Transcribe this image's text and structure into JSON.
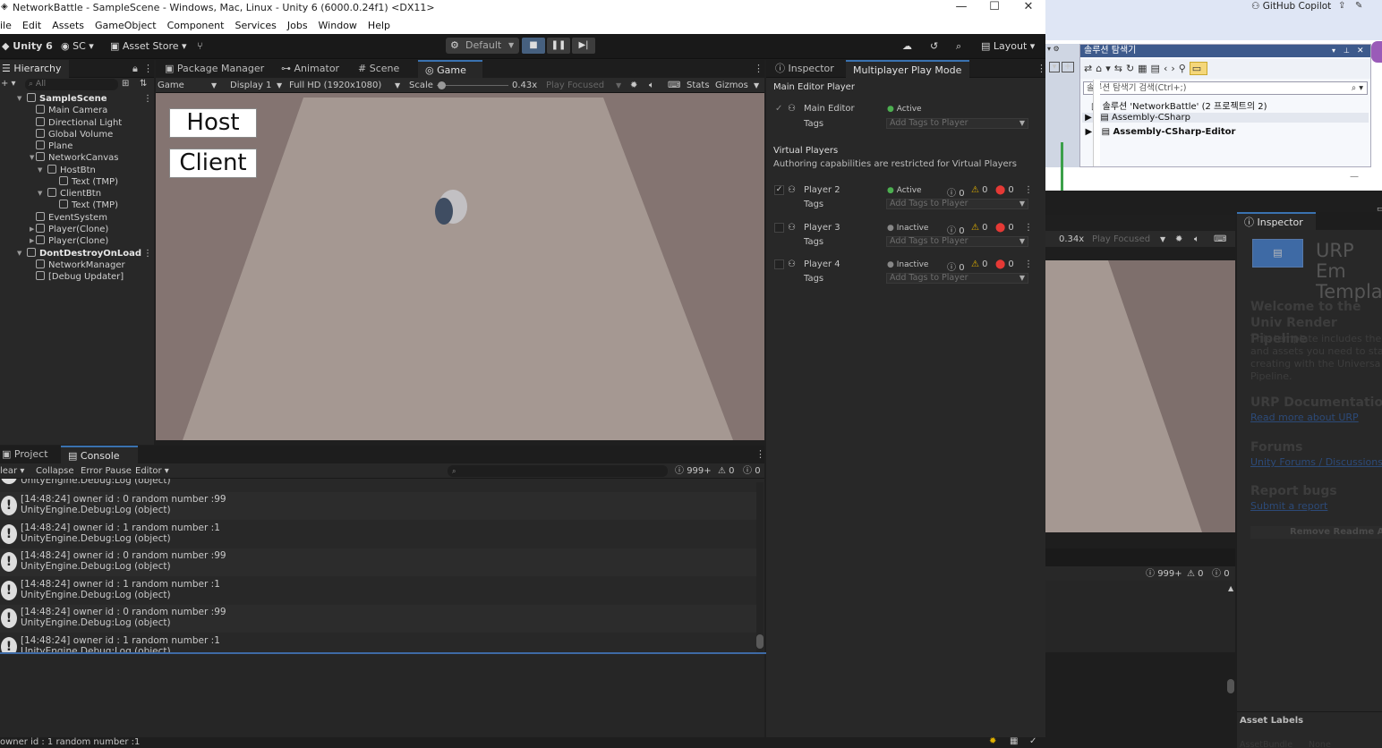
{
  "window": {
    "title": "NetworkBattle - SampleScene - Windows, Mac, Linux - Unity 6 (6000.0.24f1) <DX11>",
    "min": "—",
    "max": "☐",
    "close": "✕"
  },
  "menu": [
    "ile",
    "Edit",
    "Assets",
    "GameObject",
    "Component",
    "Services",
    "Jobs",
    "Window",
    "Help"
  ],
  "toolbar": {
    "unity": "Unity 6",
    "account": "SC",
    "asset_store": "Asset Store",
    "layout_mode": "Default",
    "layout": "Layout"
  },
  "hierarchy": {
    "tab": "Hierarchy",
    "search_placeholder": "All",
    "items": [
      {
        "label": "SampleScene",
        "bold": true,
        "indent": 0
      },
      {
        "label": "Main Camera",
        "indent": 2
      },
      {
        "label": "Directional Light",
        "indent": 2
      },
      {
        "label": "Global Volume",
        "indent": 2
      },
      {
        "label": "Plane",
        "indent": 2
      },
      {
        "label": "NetworkCanvas",
        "indent": 2
      },
      {
        "label": "HostBtn",
        "indent": 3
      },
      {
        "label": "Text (TMP)",
        "indent": 4
      },
      {
        "label": "ClientBtn",
        "indent": 3
      },
      {
        "label": "Text (TMP)",
        "indent": 4
      },
      {
        "label": "EventSystem",
        "indent": 2
      },
      {
        "label": "Player(Clone)",
        "indent": 2
      },
      {
        "label": "Player(Clone)",
        "indent": 2
      },
      {
        "label": "DontDestroyOnLoad",
        "bold": true,
        "indent": 0
      },
      {
        "label": "NetworkManager",
        "indent": 2
      },
      {
        "label": "[Debug Updater]",
        "indent": 2
      }
    ]
  },
  "center_tabs": [
    "Package Manager",
    "Animator",
    "Scene",
    "Game"
  ],
  "gamebar": {
    "mode": "Game",
    "display": "Display 1",
    "res": "Full HD (1920x1080)",
    "scale_label": "Scale",
    "scale": "0.43x",
    "play_focused": "Play Focused",
    "stats": "Stats",
    "gizmos": "Gizmos"
  },
  "game_ui": {
    "host": "Host",
    "client": "Client"
  },
  "bottom_tabs": [
    "Project",
    "Console"
  ],
  "console": {
    "clear": "lear",
    "collapse": "Collapse",
    "error_pause": "Error Pause",
    "editor": "Editor",
    "count_log": "999+",
    "count_warn": "0",
    "count_err": "0",
    "top_partial": "UnityEngine.Debug:Log (object)",
    "entries": [
      {
        "l1": "[14:48:24] owner id : 0 random number :99",
        "l2": "UnityEngine.Debug:Log (object)"
      },
      {
        "l1": "[14:48:24] owner id : 1 random number :1",
        "l2": "UnityEngine.Debug:Log (object)"
      },
      {
        "l1": "[14:48:24] owner id : 0 random number :99",
        "l2": "UnityEngine.Debug:Log (object)"
      },
      {
        "l1": "[14:48:24] owner id : 1 random number :1",
        "l2": "UnityEngine.Debug:Log (object)"
      },
      {
        "l1": "[14:48:24] owner id : 0 random number :99",
        "l2": "UnityEngine.Debug:Log (object)"
      },
      {
        "l1": "[14:48:24] owner id : 1 random number :1",
        "l2": "UnityEngine.Debug:Log (object)"
      }
    ]
  },
  "status_bar": "owner id : 1 random number :1",
  "right_tabs": [
    "Inspector",
    "Multiplayer Play Mode"
  ],
  "mppm": {
    "main_header": "Main Editor Player",
    "main_name": "Main Editor",
    "main_status": "Active",
    "tags": "Tags",
    "add_tags": "Add Tags to Player",
    "virtual_header": "Virtual Players",
    "virtual_note": "Authoring capabilities are restricted for Virtual Players",
    "players": [
      {
        "name": "Player 2",
        "status": "Active",
        "checked": true,
        "c1": "0",
        "c2": "0",
        "c3": "0"
      },
      {
        "name": "Player 3",
        "status": "Inactive",
        "checked": false,
        "c1": "0",
        "c2": "0",
        "c3": "0"
      },
      {
        "name": "Player 4",
        "status": "Inactive",
        "checked": false,
        "c1": "0",
        "c2": "0",
        "c3": "0"
      }
    ]
  },
  "vs": {
    "copilot": "GitHub Copilot",
    "panel_title": "솔루션 탐색기",
    "search_placeholder": "솔루션 탐색기 검색(Ctrl+;)",
    "solution": "솔루션 'NetworkBattle' (2 프로젝트의 2)",
    "projects": [
      "Assembly-CSharp",
      "Assembly-CSharp-Editor"
    ],
    "dash": "—"
  },
  "second": {
    "scale": "0.34x",
    "play_focused": "Play Focused",
    "inspector": "Inspector",
    "urp_title": "URP Em Templa",
    "welcome": "Welcome to the Univ Render Pipeline",
    "desc": "This template includes the and assets you need to sta creating with the Universa Pipeline.",
    "doc": "URP Documentation",
    "doc_link": "Read more about URP",
    "forums": "Forums",
    "forums_link": "Unity Forums / Discussions",
    "bugs": "Report bugs",
    "bugs_link": "Submit a report",
    "remove": "Remove Readme Ass",
    "asset_labels": "Asset Labels",
    "asset_bundle": "AssetBundle",
    "none": "None",
    "count_log": "999+",
    "count_warn": "0",
    "count_err": "0"
  }
}
